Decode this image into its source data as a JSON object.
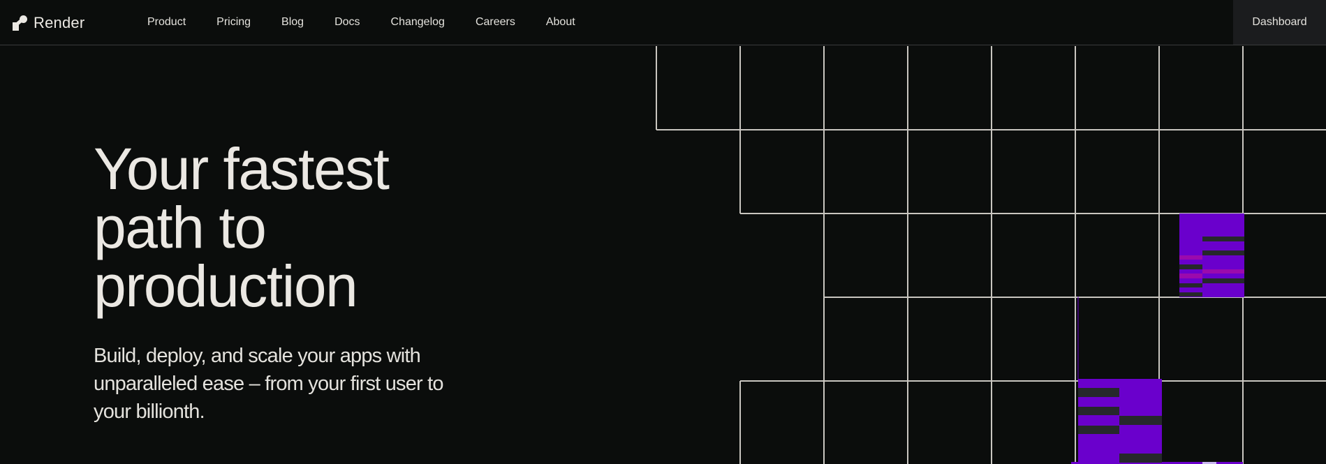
{
  "brand": {
    "name": "Render",
    "logo_icon": "render-logo-icon"
  },
  "nav": {
    "links": [
      {
        "label": "Product"
      },
      {
        "label": "Pricing"
      },
      {
        "label": "Blog"
      },
      {
        "label": "Docs"
      },
      {
        "label": "Changelog"
      },
      {
        "label": "Careers"
      },
      {
        "label": "About"
      }
    ],
    "dashboard_label": "Dashboard"
  },
  "hero": {
    "title_lines": [
      "Your fastest",
      "path to",
      "production"
    ],
    "subtitle_lines": [
      "Build, deploy, and scale your apps with",
      "unparalleled ease – from your first user to",
      "your billionth."
    ]
  },
  "colors": {
    "background": "#0b0d0c",
    "text": "#ebe8e3",
    "grid_line": "#c9c6c0",
    "accent_purple": "#6a00cc",
    "accent_magenta": "#9b0aad",
    "bar_dark": "#26282b"
  }
}
